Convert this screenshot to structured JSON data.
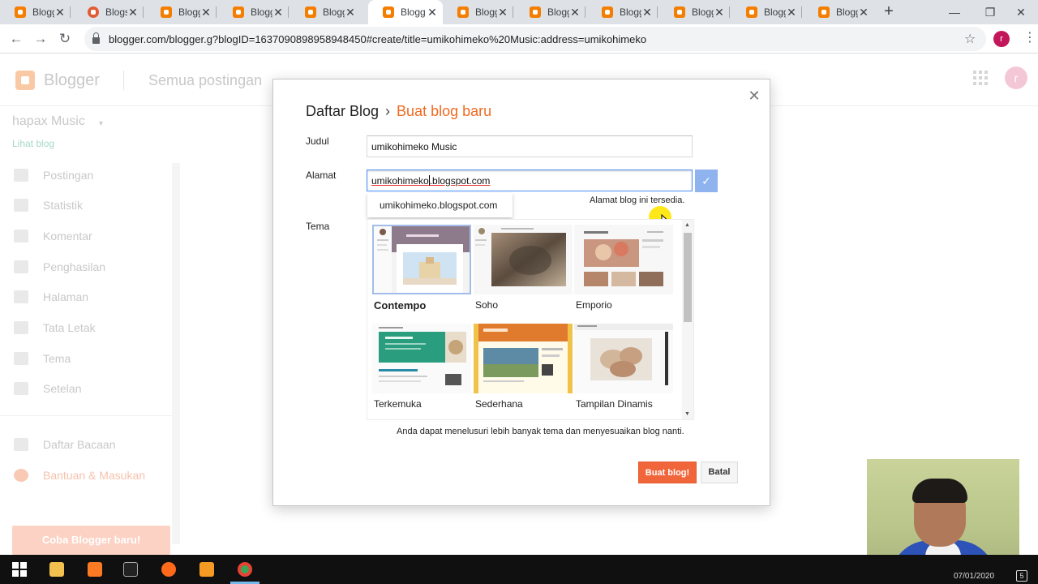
{
  "browser": {
    "tabs": [
      {
        "title": "Blogg",
        "icon": "blogger-icon",
        "active": false
      },
      {
        "title": "Blogs",
        "icon": "blogspot-icon",
        "active": false
      },
      {
        "title": "Blogg",
        "icon": "blogger-icon",
        "active": false
      },
      {
        "title": "Blogg",
        "icon": "blogger-icon",
        "active": false
      },
      {
        "title": "Blogg",
        "icon": "blogger-icon",
        "active": false
      },
      {
        "title": "Blogg",
        "icon": "blogger-icon",
        "active": true
      },
      {
        "title": "Blogg",
        "icon": "blogger-icon",
        "active": false
      },
      {
        "title": "Blogg",
        "icon": "blogger-icon",
        "active": false
      },
      {
        "title": "Blogg",
        "icon": "blogger-icon",
        "active": false
      },
      {
        "title": "Blogg",
        "icon": "blogger-icon",
        "active": false
      },
      {
        "title": "Blogg",
        "icon": "blogger-icon",
        "active": false
      },
      {
        "title": "Blogg",
        "icon": "blogger-icon",
        "active": false
      }
    ],
    "url": "blogger.com/blogger.g?blogID=1637090898958948450#create/title=umikohimeko%20Music:address=umikohimeko",
    "profile_initial": "r"
  },
  "blogger": {
    "app_name": "Blogger",
    "section": "Semua postingan",
    "avatar_initial": "r",
    "blog_name": "hapax Music",
    "view_blog": "Lihat blog",
    "nav": [
      {
        "label": "Postingan",
        "icon": "posts-icon"
      },
      {
        "label": "Statistik",
        "icon": "stats-icon"
      },
      {
        "label": "Komentar",
        "icon": "comments-icon"
      },
      {
        "label": "Penghasilan",
        "icon": "earnings-icon"
      },
      {
        "label": "Halaman",
        "icon": "pages-icon"
      },
      {
        "label": "Tata Letak",
        "icon": "layout-icon"
      },
      {
        "label": "Tema",
        "icon": "theme-icon"
      },
      {
        "label": "Setelan",
        "icon": "settings-icon"
      }
    ],
    "nav2": [
      {
        "label": "Daftar Bacaan",
        "icon": "reading-list-icon"
      },
      {
        "label": "Bantuan & Masukan",
        "icon": "help-icon"
      }
    ],
    "try_new": "Coba Blogger baru!"
  },
  "dialog": {
    "breadcrumb_parent": "Daftar Blog",
    "breadcrumb_sep": "›",
    "breadcrumb_current": "Buat blog baru",
    "title_label": "Judul",
    "title_value": "umikohimeko Music",
    "address_label": "Alamat",
    "address_value_typed": "umikohimeko",
    "address_value_suffix": ".blogspot.com",
    "address_suggestion": "umikohimeko.blogspot.com",
    "availability": "Alamat blog ini tersedia.",
    "theme_label": "Tema",
    "themes": [
      {
        "name": "Contempo",
        "selected": true
      },
      {
        "name": "Soho",
        "selected": false
      },
      {
        "name": "Emporio",
        "selected": false
      },
      {
        "name": "Terkemuka",
        "selected": false
      },
      {
        "name": "Sederhana",
        "selected": false
      },
      {
        "name": "Tampilan Dinamis",
        "selected": false
      }
    ],
    "theme_note": "Anda dapat menelusuri lebih banyak tema dan menyesuaikan blog nanti.",
    "create_button": "Buat blog!",
    "cancel_button": "Batal"
  },
  "taskbar": {
    "date": "07/01/2020",
    "notifications": "5"
  }
}
